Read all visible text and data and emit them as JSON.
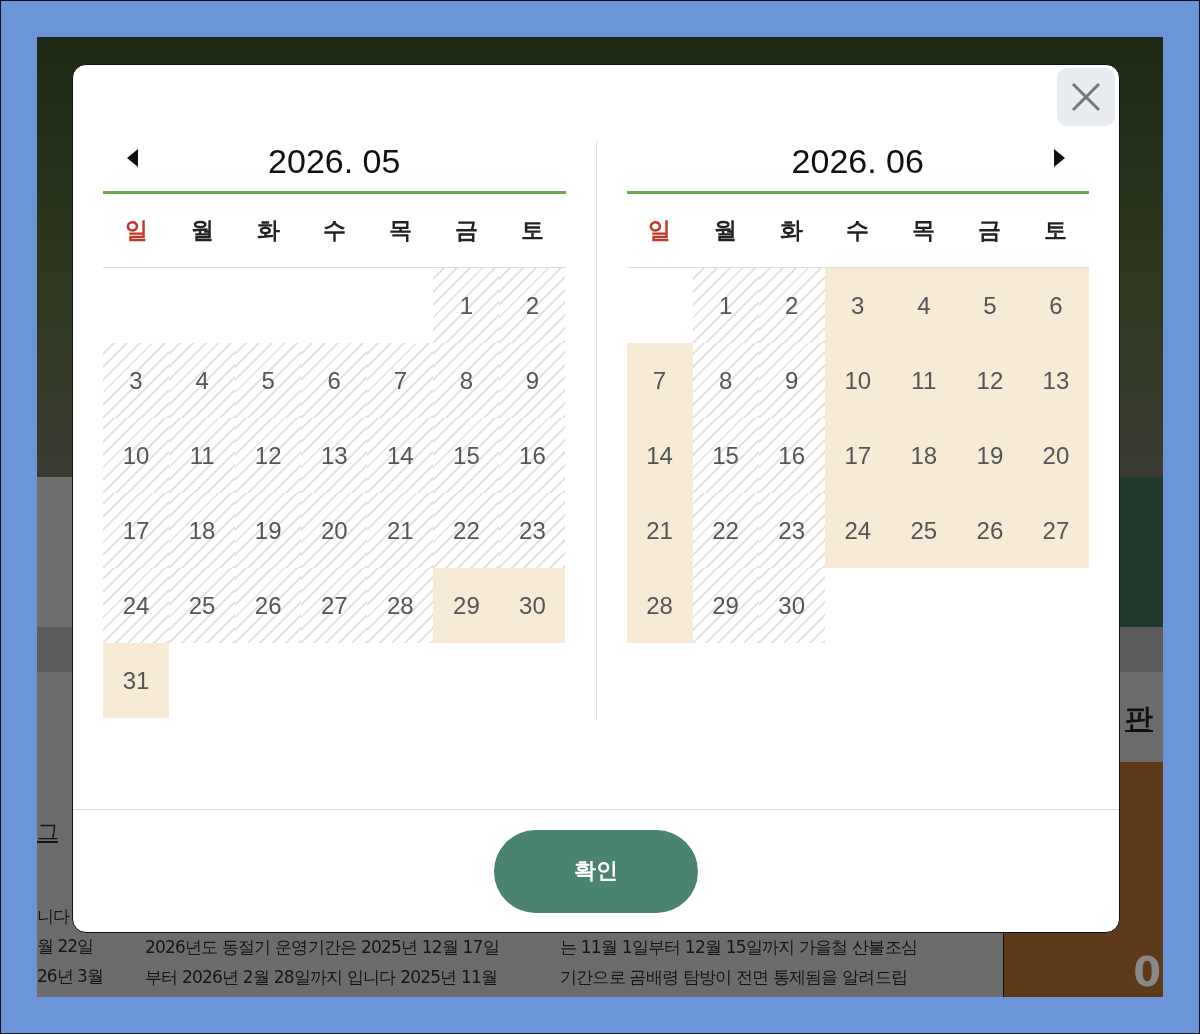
{
  "background": {
    "column_1": [
      "그",
      "니다",
      "월 22일",
      "26년 3월"
    ],
    "column_2": [
      "2026년도 동절기 운영기간은 2025년 12월 17일",
      "부터 2026년 2월 28일까지 입니다 2025년 11월"
    ],
    "column_3": [
      "는 11월 1일부터 12월 15일까지 가을철 산불조심",
      "기간으로 곰배령 탐방이 전면 통제됨을 알려드립"
    ],
    "side_heading": "판",
    "card_number": "0"
  },
  "modal": {
    "months": [
      {
        "title": "2026. 05",
        "prev_button": true,
        "next_button": false,
        "weekdays": [
          {
            "label": "일",
            "holiday": true
          },
          {
            "label": "월",
            "holiday": false
          },
          {
            "label": "화",
            "holiday": false
          },
          {
            "label": "수",
            "holiday": false
          },
          {
            "label": "목",
            "holiday": false
          },
          {
            "label": "금",
            "holiday": false
          },
          {
            "label": "토",
            "holiday": false
          }
        ],
        "weeks": [
          [
            {
              "kind": "blank"
            },
            {
              "kind": "blank"
            },
            {
              "kind": "blank"
            },
            {
              "kind": "blank"
            },
            {
              "kind": "blank"
            },
            {
              "kind": "date",
              "day": "1",
              "available": false
            },
            {
              "kind": "date",
              "day": "2",
              "available": false
            }
          ],
          [
            {
              "kind": "date",
              "day": "3",
              "available": false
            },
            {
              "kind": "date",
              "day": "4",
              "available": false
            },
            {
              "kind": "date",
              "day": "5",
              "available": false
            },
            {
              "kind": "date",
              "day": "6",
              "available": false
            },
            {
              "kind": "date",
              "day": "7",
              "available": false
            },
            {
              "kind": "date",
              "day": "8",
              "available": false
            },
            {
              "kind": "date",
              "day": "9",
              "available": false
            }
          ],
          [
            {
              "kind": "date",
              "day": "10",
              "available": false
            },
            {
              "kind": "date",
              "day": "11",
              "available": false
            },
            {
              "kind": "date",
              "day": "12",
              "available": false
            },
            {
              "kind": "date",
              "day": "13",
              "available": false
            },
            {
              "kind": "date",
              "day": "14",
              "available": false
            },
            {
              "kind": "date",
              "day": "15",
              "available": false
            },
            {
              "kind": "date",
              "day": "16",
              "available": false
            }
          ],
          [
            {
              "kind": "date",
              "day": "17",
              "available": false
            },
            {
              "kind": "date",
              "day": "18",
              "available": false
            },
            {
              "kind": "date",
              "day": "19",
              "available": false
            },
            {
              "kind": "date",
              "day": "20",
              "available": false
            },
            {
              "kind": "date",
              "day": "21",
              "available": false
            },
            {
              "kind": "date",
              "day": "22",
              "available": false
            },
            {
              "kind": "date",
              "day": "23",
              "available": false
            }
          ],
          [
            {
              "kind": "date",
              "day": "24",
              "available": false
            },
            {
              "kind": "date",
              "day": "25",
              "available": false
            },
            {
              "kind": "date",
              "day": "26",
              "available": false
            },
            {
              "kind": "date",
              "day": "27",
              "available": false
            },
            {
              "kind": "date",
              "day": "28",
              "available": false
            },
            {
              "kind": "date",
              "day": "29",
              "available": true
            },
            {
              "kind": "date",
              "day": "30",
              "available": true
            }
          ],
          [
            {
              "kind": "date",
              "day": "31",
              "available": true
            }
          ]
        ]
      },
      {
        "title": "2026. 06",
        "prev_button": false,
        "next_button": true,
        "weekdays": [
          {
            "label": "일",
            "holiday": true
          },
          {
            "label": "월",
            "holiday": false
          },
          {
            "label": "화",
            "holiday": false
          },
          {
            "label": "수",
            "holiday": false
          },
          {
            "label": "목",
            "holiday": false
          },
          {
            "label": "금",
            "holiday": false
          },
          {
            "label": "토",
            "holiday": false
          }
        ],
        "weeks": [
          [
            {
              "kind": "blank"
            },
            {
              "kind": "date",
              "day": "1",
              "available": false
            },
            {
              "kind": "date",
              "day": "2",
              "available": false
            },
            {
              "kind": "date",
              "day": "3",
              "available": true
            },
            {
              "kind": "date",
              "day": "4",
              "available": true
            },
            {
              "kind": "date",
              "day": "5",
              "available": true
            },
            {
              "kind": "date",
              "day": "6",
              "available": true
            }
          ],
          [
            {
              "kind": "date",
              "day": "7",
              "available": true
            },
            {
              "kind": "date",
              "day": "8",
              "available": false
            },
            {
              "kind": "date",
              "day": "9",
              "available": false
            },
            {
              "kind": "date",
              "day": "10",
              "available": true
            },
            {
              "kind": "date",
              "day": "11",
              "available": true
            },
            {
              "kind": "date",
              "day": "12",
              "available": true
            },
            {
              "kind": "date",
              "day": "13",
              "available": true
            }
          ],
          [
            {
              "kind": "date",
              "day": "14",
              "available": true
            },
            {
              "kind": "date",
              "day": "15",
              "available": false
            },
            {
              "kind": "date",
              "day": "16",
              "available": false
            },
            {
              "kind": "date",
              "day": "17",
              "available": true
            },
            {
              "kind": "date",
              "day": "18",
              "available": true
            },
            {
              "kind": "date",
              "day": "19",
              "available": true
            },
            {
              "kind": "date",
              "day": "20",
              "available": true
            }
          ],
          [
            {
              "kind": "date",
              "day": "21",
              "available": true
            },
            {
              "kind": "date",
              "day": "22",
              "available": false
            },
            {
              "kind": "date",
              "day": "23",
              "available": false
            },
            {
              "kind": "date",
              "day": "24",
              "available": true
            },
            {
              "kind": "date",
              "day": "25",
              "available": true
            },
            {
              "kind": "date",
              "day": "26",
              "available": true
            },
            {
              "kind": "date",
              "day": "27",
              "available": true
            }
          ],
          [
            {
              "kind": "date",
              "day": "28",
              "available": true
            },
            {
              "kind": "date",
              "day": "29",
              "available": false
            },
            {
              "kind": "date",
              "day": "30",
              "available": false
            }
          ]
        ]
      }
    ],
    "confirm_button": "확인"
  }
}
